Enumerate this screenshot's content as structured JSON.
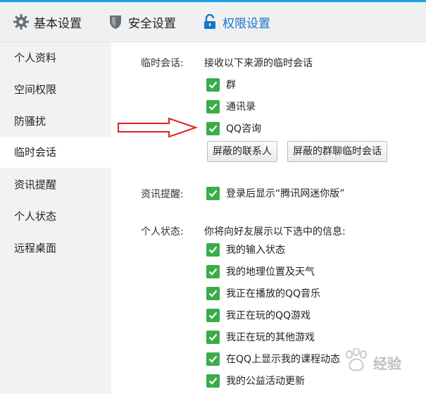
{
  "tabs": [
    {
      "label": "基本设置",
      "icon": "gear-icon"
    },
    {
      "label": "安全设置",
      "icon": "shield-icon"
    },
    {
      "label": "权限设置",
      "icon": "lock-icon",
      "active": true
    }
  ],
  "sidebar": {
    "items": [
      {
        "label": "个人资料"
      },
      {
        "label": "空间权限"
      },
      {
        "label": "防骚扰"
      },
      {
        "label": "临时会话",
        "selected": true
      },
      {
        "label": "资讯提醒"
      },
      {
        "label": "个人状态"
      },
      {
        "label": "远程桌面"
      }
    ]
  },
  "temp_session": {
    "label": "临时会话:",
    "description": "接收以下来源的临时会话",
    "options": [
      {
        "label": "群",
        "checked": true
      },
      {
        "label": "通讯录",
        "checked": true
      },
      {
        "label": "QQ咨询",
        "checked": true
      }
    ],
    "buttons": {
      "blocked_contacts": "屏蔽的联系人",
      "blocked_group_sessions": "屏蔽的群聊临时会话"
    }
  },
  "news_reminder": {
    "label": "资讯提醒:",
    "option": {
      "label": "登录后显示“腾讯网迷你版”",
      "checked": true
    }
  },
  "personal_status": {
    "label": "个人状态:",
    "description": "你将向好友展示以下选中的信息:",
    "options": [
      {
        "label": "我的输入状态",
        "checked": true
      },
      {
        "label": "我的地理位置及天气",
        "checked": true
      },
      {
        "label": "我正在播放的QQ音乐",
        "checked": true
      },
      {
        "label": "我正在玩的QQ游戏",
        "checked": true
      },
      {
        "label": "我正在玩的其他游戏",
        "checked": true
      },
      {
        "label": "在QQ上显示我的课程动态",
        "checked": true
      },
      {
        "label": "我的公益活动更新",
        "checked": true
      }
    ]
  },
  "colors": {
    "accent": "#1a76c9",
    "checkbox": "#3aad4a",
    "arrow": "#e02020",
    "sidebar_bg": "#f1f2f4"
  },
  "watermark": {
    "text": "经验"
  }
}
